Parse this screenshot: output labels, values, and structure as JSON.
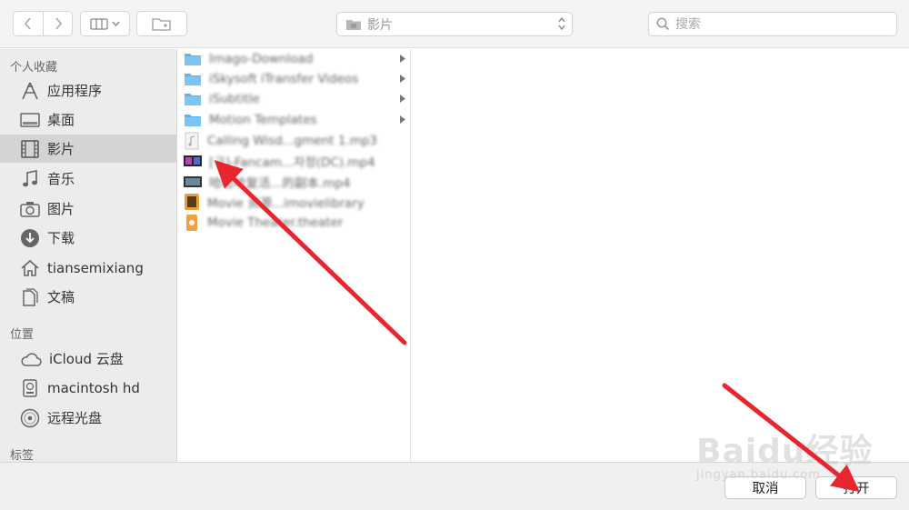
{
  "toolbar": {
    "location_label": "影片",
    "search_placeholder": "搜索"
  },
  "sidebar": {
    "favorites_title": "个人收藏",
    "favorites": [
      {
        "label": "应用程序",
        "icon": "applications-icon"
      },
      {
        "label": "桌面",
        "icon": "desktop-icon"
      },
      {
        "label": "影片",
        "icon": "movies-icon",
        "selected": true
      },
      {
        "label": "音乐",
        "icon": "music-icon"
      },
      {
        "label": "图片",
        "icon": "camera-icon"
      },
      {
        "label": "下载",
        "icon": "download-icon"
      },
      {
        "label": "tiansemixiang",
        "icon": "home-icon"
      },
      {
        "label": "文稿",
        "icon": "documents-icon"
      }
    ],
    "locations_title": "位置",
    "locations": [
      {
        "label": "iCloud 云盘",
        "icon": "cloud-icon"
      },
      {
        "label": "macintosh hd",
        "icon": "hard-drive-icon"
      },
      {
        "label": "远程光盘",
        "icon": "disc-icon"
      }
    ],
    "tags_title": "标签"
  },
  "files": [
    {
      "name": "Imago-Download",
      "icon": "folder-icon",
      "has_children": true
    },
    {
      "name": "iSkysoft iTransfer Videos",
      "icon": "folder-icon",
      "has_children": true
    },
    {
      "name": "iSubtitle",
      "icon": "folder-icon",
      "has_children": true
    },
    {
      "name": "Motion Templates",
      "icon": "folder-icon",
      "has_children": true
    },
    {
      "name": "Calling Wisd...gment 1.mp3",
      "icon": "audio-file-icon",
      "has_children": false
    },
    {
      "name": "[구]-Fancam...자정(DC).mp4",
      "icon": "video-thumbnail-icon",
      "has_children": false
    },
    {
      "name": "哈哈哈复活...的副本.mp4",
      "icon": "video-thumbnail-icon",
      "has_children": false
    },
    {
      "name": "Movie 资源...imovielibrary",
      "icon": "imovie-library-icon",
      "has_children": false
    },
    {
      "name": "Movie Theater.theater",
      "icon": "imovie-theater-icon",
      "has_children": false
    }
  ],
  "buttons": {
    "cancel": "取消",
    "open": "打开"
  },
  "watermark": {
    "line1": "Baidu经验",
    "line2": "jingyan.baidu.com"
  },
  "colors": {
    "annotation_arrow": "#e8262f",
    "folder": "#5fb3ec",
    "selected_row": "#d4d4d4"
  }
}
